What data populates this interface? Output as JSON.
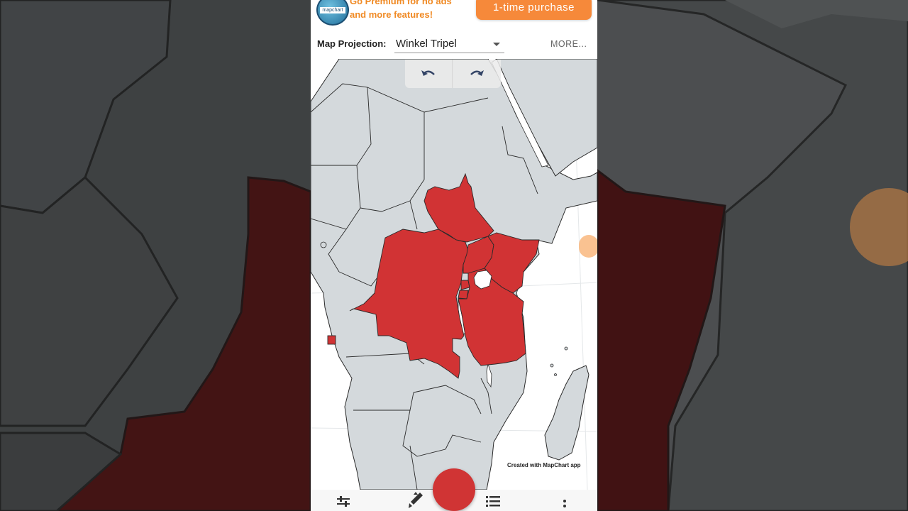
{
  "ad": {
    "promo_line1": "Go Premium for no ads",
    "promo_line2": "and more features!",
    "logo_text": "mapchart",
    "purchase_button": "1-time purchase"
  },
  "projection": {
    "label": "Map Projection:",
    "value": "Winkel Tripel",
    "more": "MORE..."
  },
  "map": {
    "credit": "Created with MapChart app",
    "highlight_color": "#d13334",
    "land_color": "#d4d9dc",
    "water_color": "#ffffff"
  },
  "toolbar": {
    "undo_icon": "undo-icon",
    "redo_icon": "redo-icon"
  },
  "bottom_nav": {
    "items": [
      "settings-sliders-icon",
      "brush-icon",
      "list-icon",
      "more-vertical-icon"
    ],
    "fab_color": "#d03434"
  },
  "accent_color": "#f6893a"
}
